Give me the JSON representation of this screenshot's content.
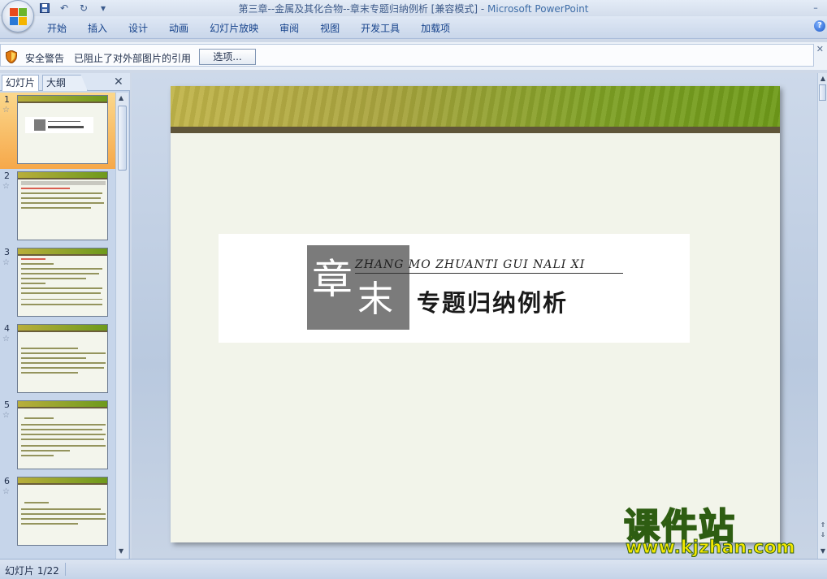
{
  "window": {
    "title": "第三章--金属及其化合物--章末专题归纳例析 [兼容模式]",
    "app_name": "Microsoft PowerPoint"
  },
  "ribbon": {
    "tabs": [
      "开始",
      "插入",
      "设计",
      "动画",
      "幻灯片放映",
      "审阅",
      "视图",
      "开发工具",
      "加载项"
    ]
  },
  "message_bar": {
    "title": "安全警告",
    "text": "已阻止了对外部图片的引用",
    "button": "选项..."
  },
  "panel": {
    "tabs": [
      "幻灯片",
      "大纲"
    ],
    "slides": [
      {
        "num": "1",
        "selected": true
      },
      {
        "num": "2",
        "selected": false
      },
      {
        "num": "3",
        "selected": false
      },
      {
        "num": "4",
        "selected": false
      },
      {
        "num": "5",
        "selected": false
      },
      {
        "num": "6",
        "selected": false
      }
    ]
  },
  "slide": {
    "pinyin": "ZHANG MO ZHUANTI GUI NALI XI",
    "stamp_char1": "章",
    "stamp_char2": "末",
    "title": "专题归纳例析"
  },
  "status": {
    "slide_indicator": "幻灯片 1/22"
  },
  "watermark": {
    "brand": "课件站",
    "url": "www.kjzhan.com"
  },
  "colors": {
    "accent_header": "#7ea024",
    "selected_thumb": "#f6a84a"
  }
}
